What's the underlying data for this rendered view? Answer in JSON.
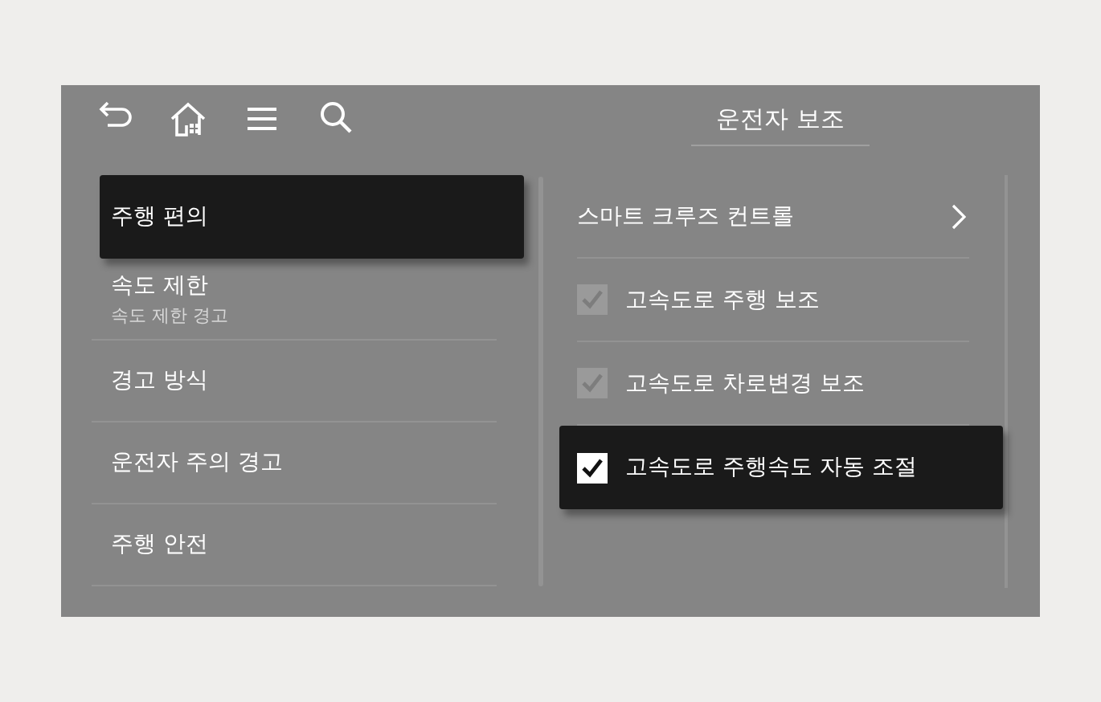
{
  "toolbar": {
    "title": "운전자 보조"
  },
  "menu": [
    {
      "label": "주행 편의",
      "selected": true
    },
    {
      "label": "속도 제한",
      "subtitle": "속도 제한 경고",
      "selected": false
    },
    {
      "label": "경고 방식",
      "selected": false
    },
    {
      "label": "운전자 주의 경고",
      "selected": false
    },
    {
      "label": "주행 안전",
      "selected": false
    }
  ],
  "settings": [
    {
      "kind": "link",
      "label": "스마트 크루즈 컨트롤",
      "selected": false
    },
    {
      "kind": "checkbox",
      "label": "고속도로 주행 보조",
      "checked": true,
      "disabled": true,
      "selected": false
    },
    {
      "kind": "checkbox",
      "label": "고속도로 차로변경 보조",
      "checked": true,
      "disabled": true,
      "selected": false
    },
    {
      "kind": "checkbox",
      "label": "고속도로 주행속도 자동 조절",
      "checked": true,
      "disabled": false,
      "selected": true
    }
  ]
}
